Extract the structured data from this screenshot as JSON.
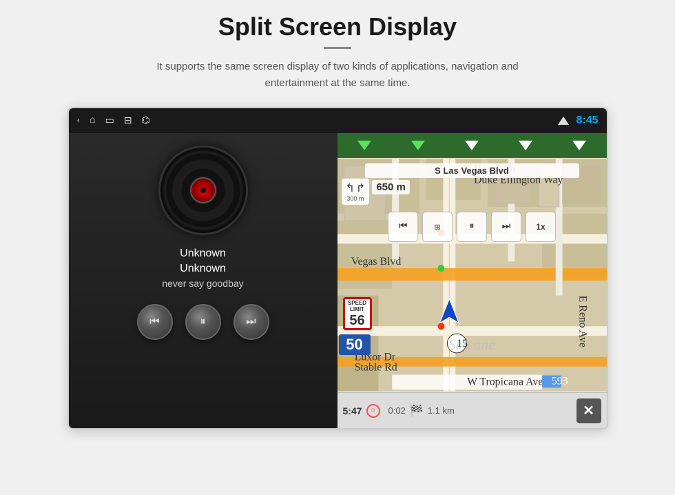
{
  "page": {
    "title": "Split Screen Display",
    "subtitle": "It supports the same screen display of two kinds of applications, navigation and entertainment at the same time.",
    "divider": true
  },
  "status_bar": {
    "time": "8:45",
    "icons": [
      "back",
      "home",
      "recent",
      "screenshot",
      "usb"
    ]
  },
  "music_panel": {
    "track_name": "Unknown",
    "track_artist": "Unknown",
    "track_song": "never say goodbay",
    "controls": [
      "prev",
      "pause",
      "next"
    ]
  },
  "nav_panel": {
    "road_name": "S Las Vegas Blvd",
    "turn_distance": "300 m",
    "dist_to_turn": "650 m",
    "current_speed": "50",
    "speed_limit": "56",
    "highway_number": "15",
    "bottom_bar": {
      "time": "5:47",
      "duration": "0:02",
      "distance": "1.1 km"
    },
    "media_controls": [
      "prev",
      "chapters",
      "pause",
      "next",
      "1x"
    ]
  },
  "watermark": "Seicane"
}
